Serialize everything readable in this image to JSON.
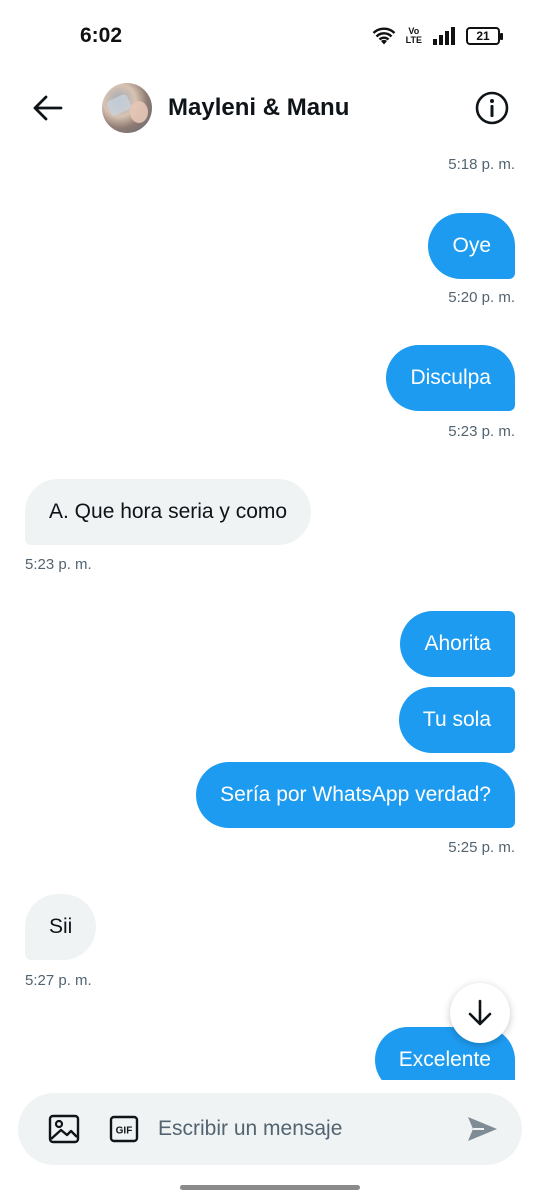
{
  "status_bar": {
    "time": "6:02",
    "volte_line1": "Vo",
    "volte_line2": "LTE",
    "battery": "21"
  },
  "header": {
    "title": "Mayleni & Manu",
    "back_icon": "arrow-left-icon",
    "info_icon": "info-icon"
  },
  "messages": [
    {
      "type": "timestamp",
      "side": "right",
      "text": "5:18 p. m."
    },
    {
      "type": "bubble",
      "side": "sent",
      "text": "Oye"
    },
    {
      "type": "timestamp",
      "side": "right",
      "text": "5:20 p. m."
    },
    {
      "type": "bubble",
      "side": "sent",
      "text": "Disculpa"
    },
    {
      "type": "timestamp",
      "side": "right",
      "text": "5:23 p. m."
    },
    {
      "type": "bubble",
      "side": "received",
      "text": "A. Que hora seria y como"
    },
    {
      "type": "timestamp",
      "side": "left",
      "text": "5:23 p. m."
    },
    {
      "type": "bubble",
      "side": "sent",
      "text": "Ahorita"
    },
    {
      "type": "bubble",
      "side": "sent",
      "text": "Tu sola"
    },
    {
      "type": "bubble",
      "side": "sent",
      "text": "Sería por WhatsApp verdad?"
    },
    {
      "type": "timestamp",
      "side": "right",
      "text": "5:25 p. m."
    },
    {
      "type": "bubble",
      "side": "received",
      "text": "Sii"
    },
    {
      "type": "timestamp",
      "side": "left",
      "text": "5:27 p. m."
    },
    {
      "type": "bubble",
      "side": "sent",
      "text": "Excelente"
    }
  ],
  "composer": {
    "placeholder": "Escribir un mensaje",
    "gif_label": "GIF"
  },
  "colors": {
    "accent": "#1d9bf0",
    "received_bubble": "#eff3f4",
    "secondary_text": "#536471"
  }
}
